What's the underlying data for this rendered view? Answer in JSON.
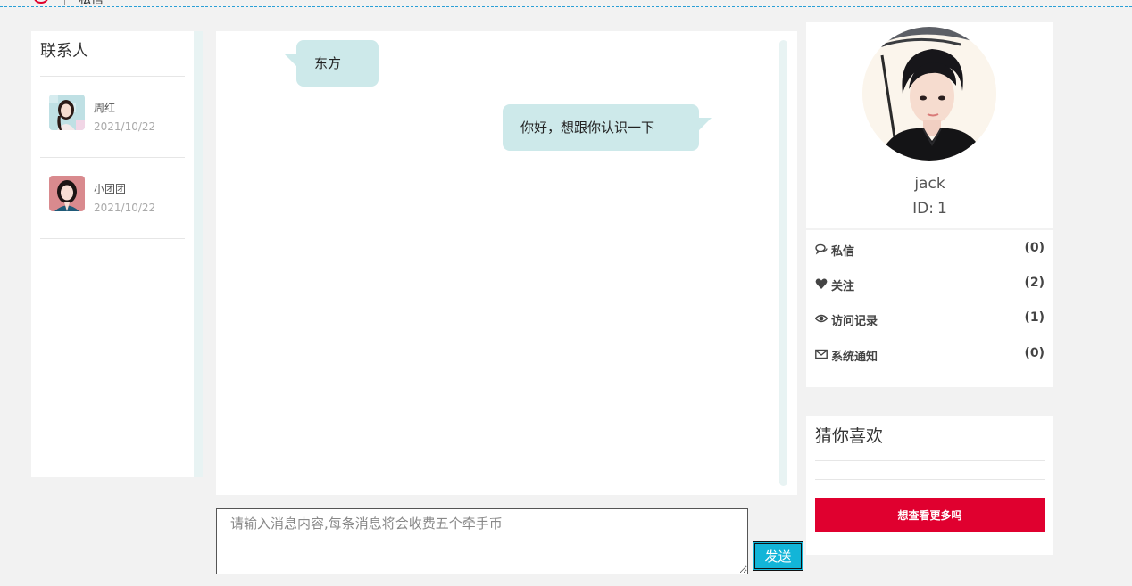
{
  "header": {
    "title": "私信"
  },
  "contacts": {
    "title": "联系人",
    "items": [
      {
        "name": "周红",
        "date": "2021/10/22"
      },
      {
        "name": "小团团",
        "date": "2021/10/22"
      }
    ]
  },
  "chat": {
    "messages": [
      {
        "side": "left",
        "text": "东方"
      },
      {
        "side": "right",
        "text": "你好，想跟你认识一下"
      }
    ]
  },
  "composer": {
    "placeholder": "请输入消息内容,每条消息将会收费五个牵手币",
    "send_label": "发送"
  },
  "profile": {
    "name": "jack",
    "id_label": "ID:",
    "id_value": "1",
    "stats": [
      {
        "icon": "chat-bubbles-icon",
        "label": "私信",
        "count": "(0)"
      },
      {
        "icon": "heart-icon",
        "label": "关注",
        "count": "(2)"
      },
      {
        "icon": "eye-icon",
        "label": "访问记录",
        "count": "(1)"
      },
      {
        "icon": "envelope-icon",
        "label": "系统通知",
        "count": "(0)"
      }
    ]
  },
  "guess": {
    "title": "猜你喜欢",
    "button_label": "想查看更多吗"
  },
  "colors": {
    "bubble": "#cde9ea",
    "send_button": "#12b5d8",
    "more_button": "#e0002f",
    "header_dash": "#2a9fd6"
  }
}
